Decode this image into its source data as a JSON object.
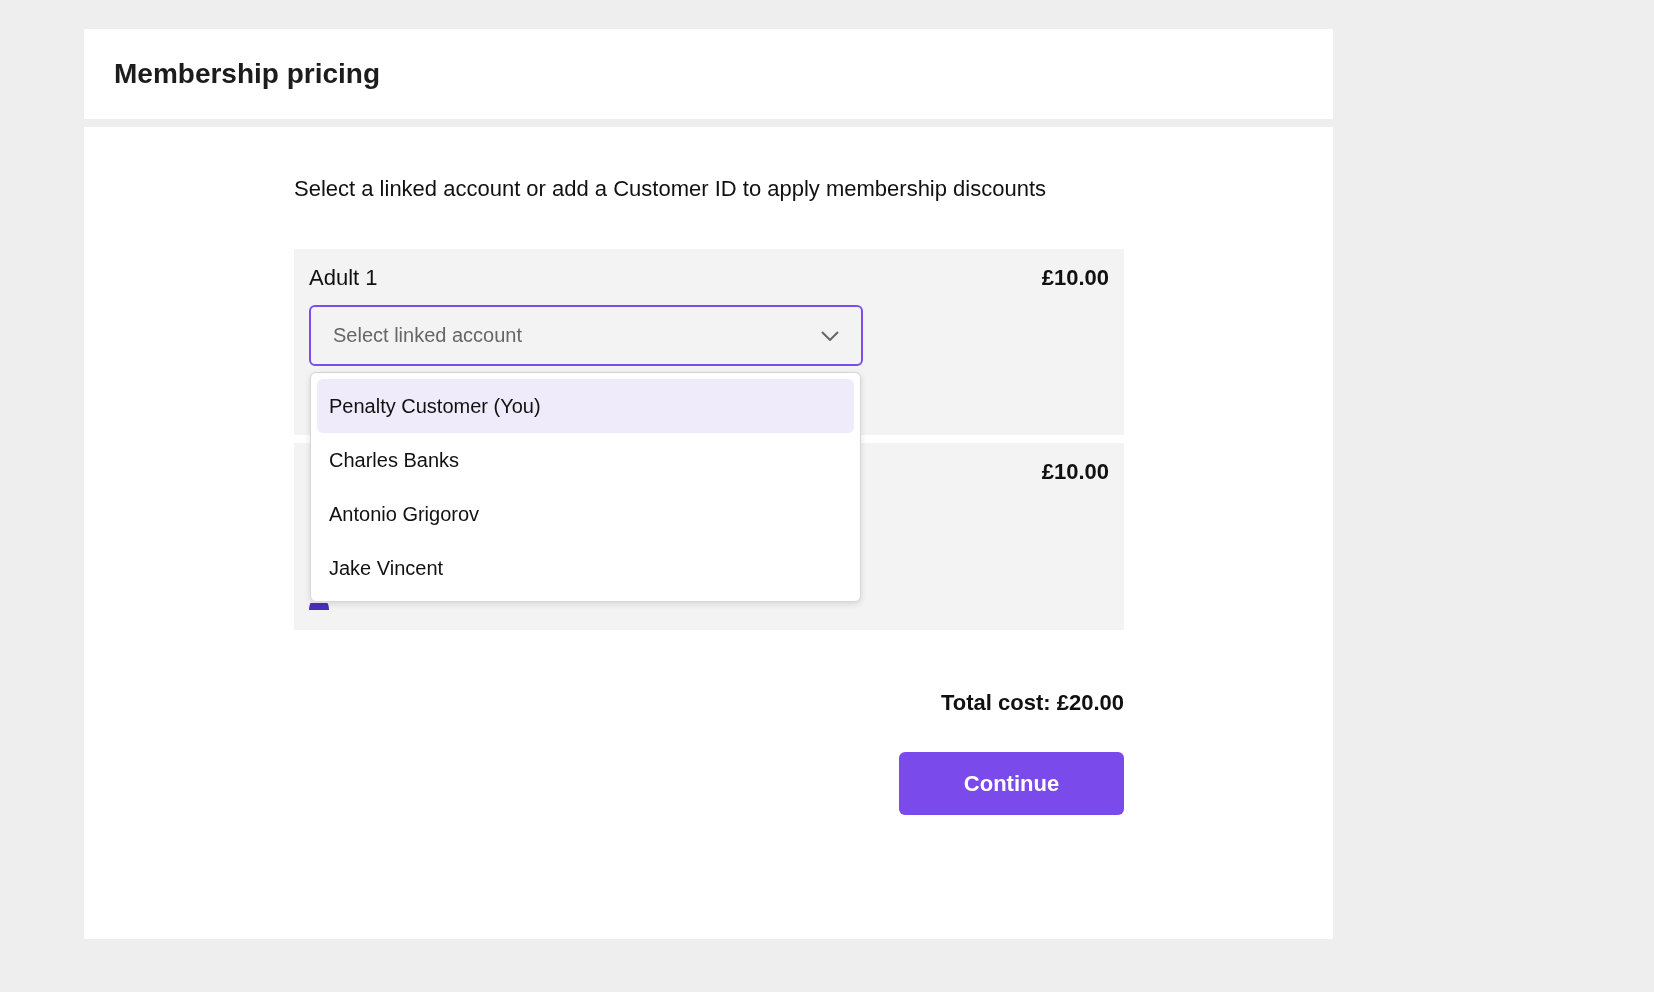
{
  "header": {
    "title": "Membership pricing"
  },
  "intro": "Select a linked account or add a Customer ID to apply membership discounts",
  "passengers": [
    {
      "label": "Adult 1",
      "price": "£10.00",
      "select": {
        "placeholder": "Select linked account",
        "expanded": true,
        "options": [
          {
            "label": "Penalty Customer (You)",
            "selected": true
          },
          {
            "label": "Charles Banks",
            "selected": false
          },
          {
            "label": "Antonio Grigorov",
            "selected": false
          },
          {
            "label": "Jake Vincent",
            "selected": false
          }
        ]
      }
    },
    {
      "price": "£10.00"
    }
  ],
  "total": "Total cost: £20.00",
  "buttons": [
    "Continue"
  ]
}
